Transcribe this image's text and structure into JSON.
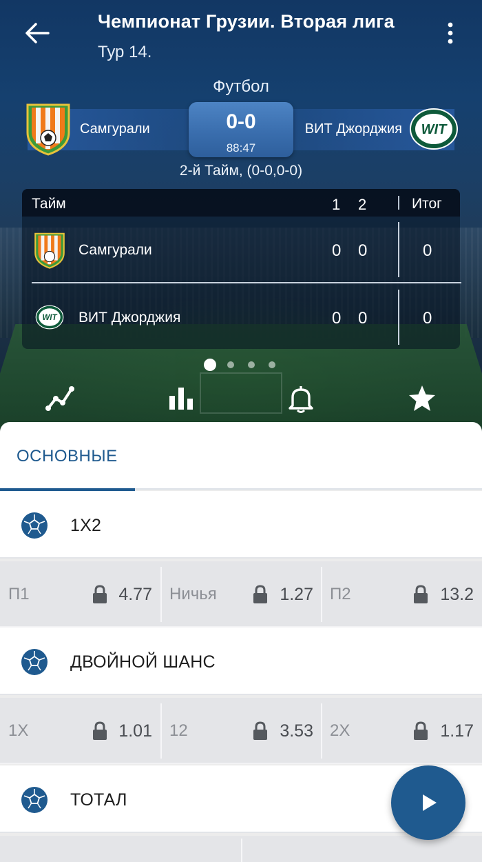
{
  "header": {
    "title": "Чемпионат Грузии. Вторая лига",
    "subtitle": "Тур 14."
  },
  "match": {
    "sport": "Футбол",
    "home_team": "Самгурали",
    "away_team": "ВИТ Джорджия",
    "score": "0-0",
    "time": "88:47",
    "period": "2-й Тайм, (0-0,0-0)"
  },
  "score_table": {
    "header_label": "Тайм",
    "period_1": "1",
    "period_2": "2",
    "total_label": "Итог",
    "rows": [
      {
        "team": "Самгурали",
        "p1": "0",
        "p2": "0",
        "total": "0"
      },
      {
        "team": "ВИТ Джорджия",
        "p1": "0",
        "p2": "0",
        "total": "0"
      }
    ]
  },
  "carousel": {
    "pages": 4,
    "active": 1
  },
  "toolbar_icons": [
    "trend-icon",
    "stats-bars-icon",
    "bell-icon",
    "star-icon"
  ],
  "tabs": [
    {
      "label": "ОСНОВНЫЕ",
      "active": true
    }
  ],
  "markets": [
    {
      "title": "1X2",
      "odds": [
        {
          "label": "П1",
          "value": "4.77"
        },
        {
          "label": "Ничья",
          "value": "1.27"
        },
        {
          "label": "П2",
          "value": "13.2"
        }
      ]
    },
    {
      "title": "ДВОЙНОЙ ШАНС",
      "odds": [
        {
          "label": "1X",
          "value": "1.01"
        },
        {
          "label": "12",
          "value": "3.53"
        },
        {
          "label": "2X",
          "value": "1.17"
        }
      ]
    },
    {
      "title": "ТОТАЛ",
      "odds": []
    }
  ],
  "colors": {
    "accent": "#1f5a8f",
    "hero_top": "#123764",
    "odds_bg": "#e4e5e8",
    "text_dark": "#1e1e1e",
    "text_muted": "#8c8f95"
  }
}
